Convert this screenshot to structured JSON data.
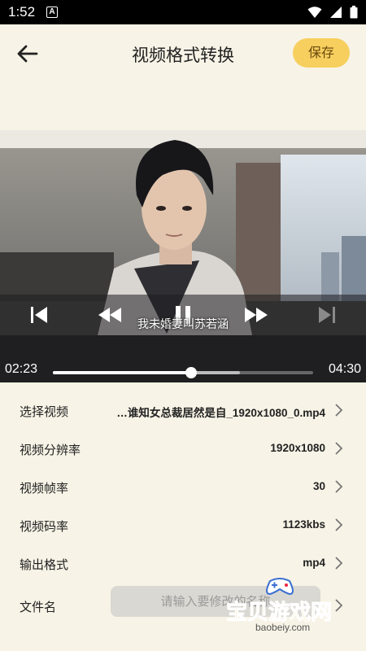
{
  "status_bar": {
    "time": "1:52",
    "badge": "A"
  },
  "header": {
    "title": "视频格式转换",
    "save_label": "保存"
  },
  "player": {
    "subtitle": "我未婚妻叫苏若涵",
    "current_time": "02:23",
    "total_time": "04:30",
    "progress_fraction": 0.53,
    "buffered_fraction": 0.72
  },
  "settings": {
    "select_video": {
      "label": "选择视频",
      "value": "…谁知女总裁居然是自_1920x1080_0.mp4"
    },
    "resolution": {
      "label": "视频分辨率",
      "value": "1920x1080"
    },
    "frame_rate": {
      "label": "视频帧率",
      "value": "30"
    },
    "bitrate": {
      "label": "视频码率",
      "value": "1123kbs"
    },
    "output_format": {
      "label": "输出格式",
      "value": "mp4"
    },
    "file_name": {
      "label": "文件名",
      "placeholder": "请输入要修改的名称"
    }
  },
  "watermark": {
    "text": "宝贝游戏网",
    "url": "baobeiy.com"
  },
  "colors": {
    "accent": "#f7cf5e",
    "background": "#f7f3e6",
    "player_bg": "#1f1f21"
  }
}
